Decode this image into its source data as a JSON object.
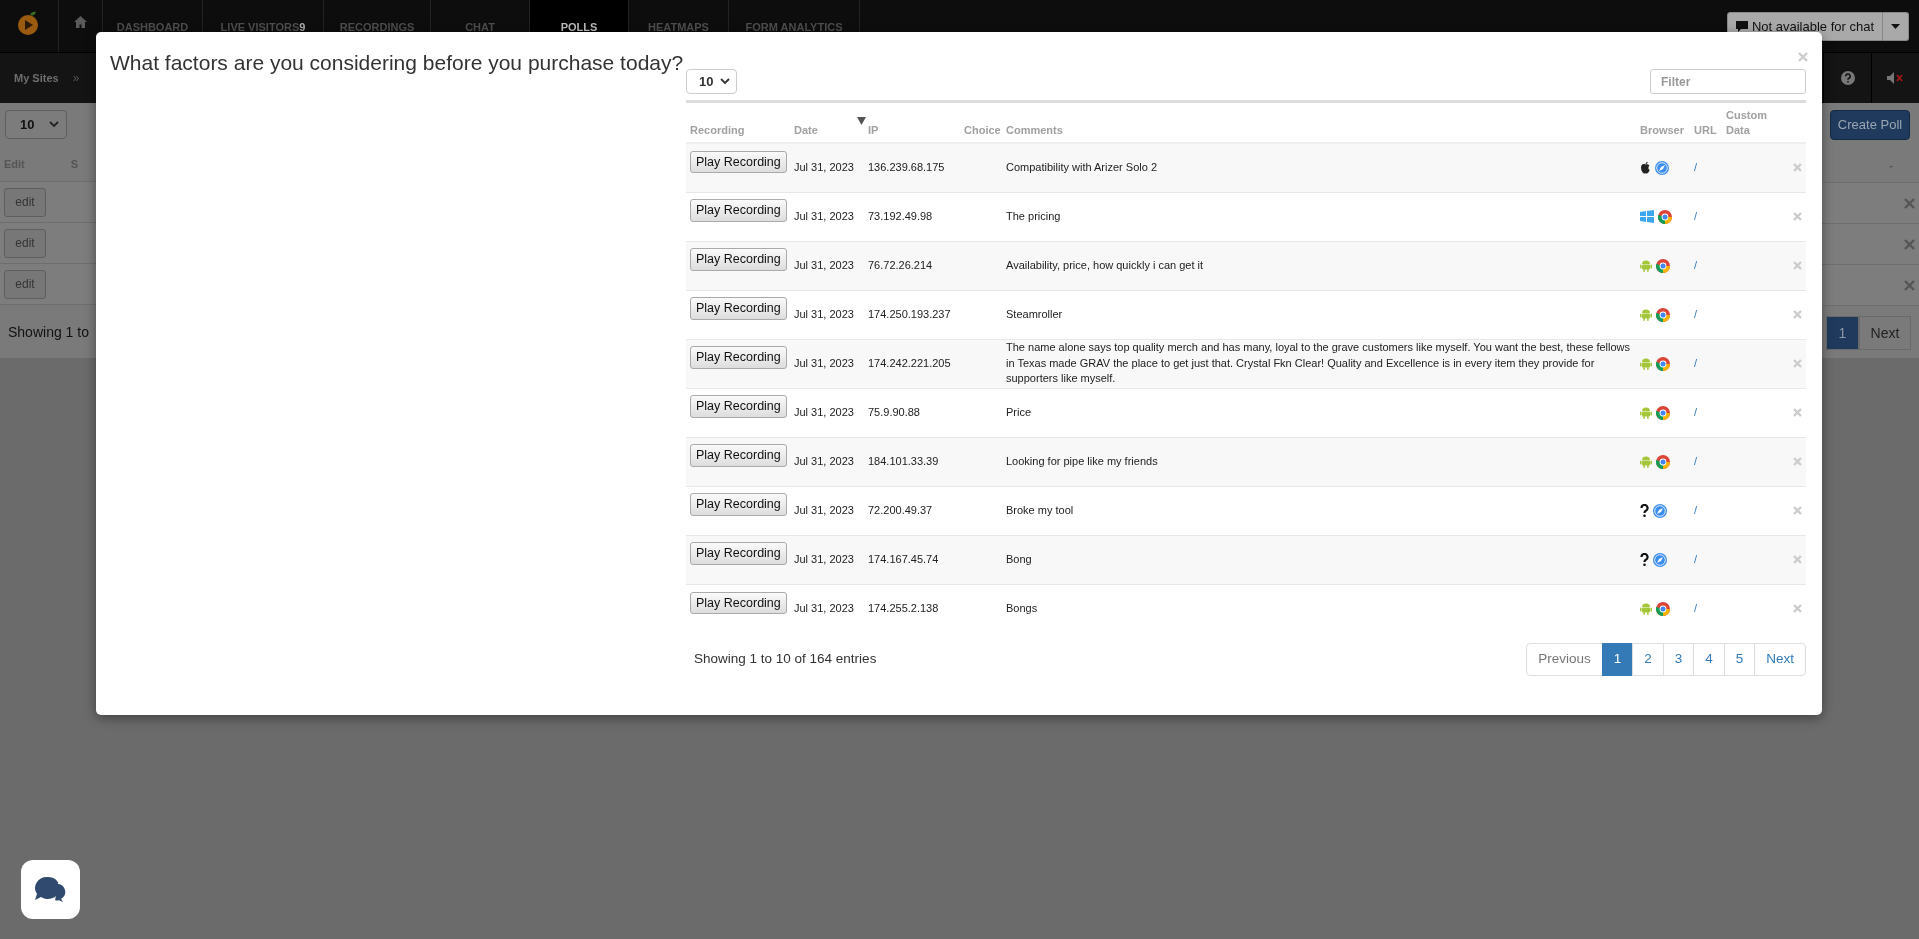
{
  "nav": {
    "tabs": [
      {
        "label": "DASHBOARD",
        "selected": false
      },
      {
        "label": "LIVE VISITORS",
        "count": "9",
        "selected": false
      },
      {
        "label": "RECORDINGS",
        "selected": false
      },
      {
        "label": "CHAT",
        "selected": false
      },
      {
        "label": "POLLS",
        "selected": true
      },
      {
        "label": "HEATMAPS",
        "selected": false
      },
      {
        "label": "FORM ANALYTICS",
        "selected": false
      }
    ],
    "chat_status": "Not available for chat"
  },
  "subnav": {
    "breadcrumb": "My Sites",
    "separator": "»"
  },
  "background_page": {
    "page_size": "10",
    "create_button": "Create Poll",
    "columns": [
      "Edit",
      "S"
    ],
    "last_column": "-",
    "rows": [
      {
        "action": "edit"
      },
      {
        "action": "edit"
      },
      {
        "action": "edit"
      }
    ],
    "showing": "Showing 1 to",
    "pagination": [
      {
        "label": "1",
        "selected": true
      },
      {
        "label": "Next",
        "selected": false
      }
    ]
  },
  "modal": {
    "title": "What factors are you considering before you purchase today?",
    "page_size": "10",
    "filter_placeholder": "Filter",
    "columns": [
      {
        "label": "Recording",
        "sorted": false
      },
      {
        "label": "Date",
        "sorted": true
      },
      {
        "label": "IP",
        "sorted": false
      },
      {
        "label": "Choice",
        "sorted": false
      },
      {
        "label": "Comments",
        "sorted": false
      },
      {
        "label": "Browser",
        "sorted": false
      },
      {
        "label": "URL",
        "sorted": false
      },
      {
        "label": "Custom Data",
        "sorted": false
      }
    ],
    "rows": [
      {
        "action": "Play Recording",
        "date": "Jul 31, 2023",
        "ip": "136.239.68.175",
        "comment": "Compatibility with Arizer Solo 2",
        "icons": [
          {
            "kind": "apple"
          },
          {
            "kind": "safari"
          }
        ],
        "url": "/"
      },
      {
        "action": "Play Recording",
        "date": "Jul 31, 2023",
        "ip": "73.192.49.98",
        "comment": "The pricing",
        "icons": [
          {
            "kind": "windows"
          },
          {
            "kind": "chrome"
          }
        ],
        "url": "/"
      },
      {
        "action": "Play Recording",
        "date": "Jul 31, 2023",
        "ip": "76.72.26.214",
        "comment": "Availability, price, how quickly i can get it",
        "icons": [
          {
            "kind": "android"
          },
          {
            "kind": "chrome"
          }
        ],
        "url": "/"
      },
      {
        "action": "Play Recording",
        "date": "Jul 31, 2023",
        "ip": "174.250.193.237",
        "comment": "Steamroller",
        "icons": [
          {
            "kind": "android"
          },
          {
            "kind": "chrome"
          }
        ],
        "url": "/"
      },
      {
        "action": "Play Recording",
        "date": "Jul 31, 2023",
        "ip": "174.242.221.205",
        "comment": "The name alone says top quality merch and has many, loyal to the grave customers like myself. You want the best, these fellows in Texas made GRAV the place to get just that. Crystal Fkn Clear! Quality and Excellence is in every item they provide for supporters like myself.",
        "icons": [
          {
            "kind": "android"
          },
          {
            "kind": "chrome"
          }
        ],
        "url": "/"
      },
      {
        "action": "Play Recording",
        "date": "Jul 31, 2023",
        "ip": "75.9.90.88",
        "comment": "Price",
        "icons": [
          {
            "kind": "android"
          },
          {
            "kind": "chrome"
          }
        ],
        "url": "/"
      },
      {
        "action": "Play Recording",
        "date": "Jul 31, 2023",
        "ip": "184.101.33.39",
        "comment": "Looking for pipe like my friends",
        "icons": [
          {
            "kind": "android"
          },
          {
            "kind": "chrome"
          }
        ],
        "url": "/"
      },
      {
        "action": "Play Recording",
        "date": "Jul 31, 2023",
        "ip": "72.200.49.37",
        "comment": "Broke my tool",
        "icons": [
          {
            "kind": "unknown"
          },
          {
            "kind": "safari"
          }
        ],
        "url": "/"
      },
      {
        "action": "Play Recording",
        "date": "Jul 31, 2023",
        "ip": "174.167.45.74",
        "comment": "Bong",
        "icons": [
          {
            "kind": "unknown"
          },
          {
            "kind": "safari"
          }
        ],
        "url": "/"
      },
      {
        "action": "Play Recording",
        "date": "Jul 31, 2023",
        "ip": "174.255.2.138",
        "comment": "Bongs",
        "icons": [
          {
            "kind": "android"
          },
          {
            "kind": "chrome"
          }
        ],
        "url": "/"
      }
    ],
    "showing": "Showing 1 to 10 of 164 entries",
    "pagination": [
      {
        "label": "Previous",
        "selected": false,
        "disabled": true
      },
      {
        "label": "1",
        "selected": true,
        "disabled": false
      },
      {
        "label": "2",
        "selected": false,
        "disabled": false
      },
      {
        "label": "3",
        "selected": false,
        "disabled": false
      },
      {
        "label": "4",
        "selected": false,
        "disabled": false
      },
      {
        "label": "5",
        "selected": false,
        "disabled": false
      },
      {
        "label": "Next",
        "selected": false,
        "disabled": false
      }
    ]
  }
}
